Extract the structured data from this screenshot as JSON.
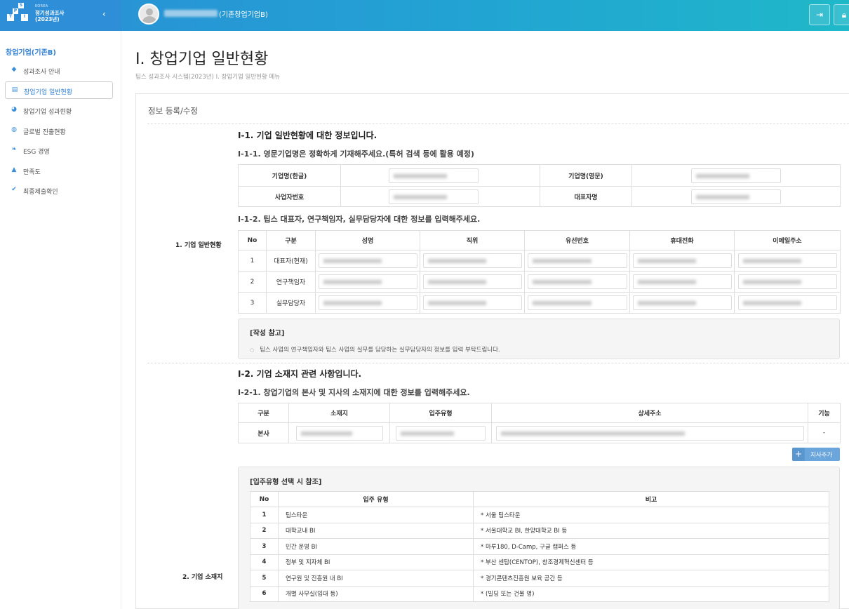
{
  "header": {
    "logo": {
      "korea": "KOREA",
      "line1": "정기성과조사",
      "line2": "(2023년)",
      "letters": [
        "S",
        "P",
        "T",
        "I"
      ]
    },
    "user_org": "(기존창업기업B)",
    "icons": [
      "logout-icon",
      "lock-icon"
    ]
  },
  "sidebar": {
    "title": "창업기업(기존B)",
    "items": [
      {
        "label": "성과조사 안내",
        "icon": "diamond-icon"
      },
      {
        "label": "창업기업 일반현황",
        "icon": "document-icon"
      },
      {
        "label": "창업기업 성과현황",
        "icon": "pie-chart-icon"
      },
      {
        "label": "글로벌 진출현황",
        "icon": "globe-icon"
      },
      {
        "label": "ESG 경영",
        "icon": "leaf-icon"
      },
      {
        "label": "만족도",
        "icon": "thumbs-up-icon"
      },
      {
        "label": "최종제출확인",
        "icon": "check-icon"
      }
    ]
  },
  "page": {
    "title": "I. 창업기업 일반현황",
    "breadcrumb": "팁스 성과조사 시스템(2023년) I. 창업기업 일반현황 메뉴",
    "panel_title": "정보 등록/수정"
  },
  "section1": {
    "label": "1. 기업 일반현황",
    "heading": "I-1. 기업 일반현황에 대한 정보입니다.",
    "sub1": "I-1-1. 영문기업명은 정확하게 기재해주세요.(특허 검색 등에 활용 예정)",
    "company_labels": {
      "name_kr": "기업명(한글)",
      "name_en": "기업명(영문)",
      "biz_no": "사업자번호",
      "ceo": "대표자명"
    },
    "sub2": "I-1-2. 팁스 대표자, 연구책임자, 실무담당자에 대한 정보를 입력해주세요.",
    "people_headers": [
      "No",
      "구분",
      "성명",
      "직위",
      "유선번호",
      "휴대전화",
      "이메일주소"
    ],
    "people_rows": [
      {
        "no": "1",
        "role": "대표자(현재)"
      },
      {
        "no": "2",
        "role": "연구책임자"
      },
      {
        "no": "3",
        "role": "실무담당자"
      }
    ],
    "note_title": "[작성 참고]",
    "note_text": "팁스 사업의 연구책임자와 팁스 사업의 실무를 담당하는 실무담당자의 정보를 입력 부탁드립니다."
  },
  "section2": {
    "label": "2. 기업 소재지",
    "heading": "I-2. 기업 소재지 관련 사항입니다.",
    "sub1": "I-2-1. 창업기업의 본사 및 지사의 소재지에 대한 정보를 입력해주세요.",
    "loc_headers": [
      "구분",
      "소재지",
      "입주유형",
      "상세주소",
      "기능"
    ],
    "loc_row": {
      "type": "본사",
      "func": "-"
    },
    "add_button": "지사추가",
    "ref_title": "[입주유형 선택 시 참조]",
    "ref_headers": [
      "No",
      "입주 유형",
      "비고"
    ],
    "ref_rows": [
      {
        "no": "1",
        "type": "팁스타운",
        "note": "* 서울 팁스타운"
      },
      {
        "no": "2",
        "type": "대학교내 BI",
        "note": "* 서울대학교 BI, 한양대학교 BI 등"
      },
      {
        "no": "3",
        "type": "민간 운영 BI",
        "note": "* 마루180, D-Camp, 구글 캠퍼스 등"
      },
      {
        "no": "4",
        "type": "정부 및 지자체 BI",
        "note": "* 부산 센탑(CENTOP), 창조경제혁신센터 등"
      },
      {
        "no": "5",
        "type": "연구원 및 진흥원 내 BI",
        "note": "* 경기콘텐츠진흥원 보육 공간 등"
      },
      {
        "no": "6",
        "type": "개별 사무실(임대 등)",
        "note": "* (빌딩 또는 건물 명)"
      }
    ]
  }
}
